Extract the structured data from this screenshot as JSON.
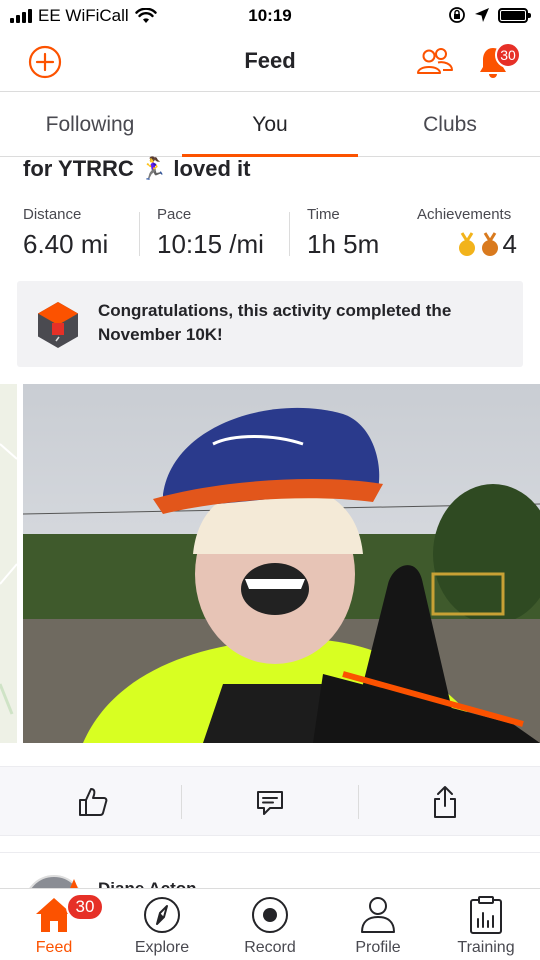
{
  "status_bar": {
    "carrier": "EE WiFiCall",
    "time": "10:19"
  },
  "header": {
    "title": "Feed",
    "notification_count": "30"
  },
  "tabs": [
    {
      "label": "Following",
      "active": false
    },
    {
      "label": "You",
      "active": true
    },
    {
      "label": "Clubs",
      "active": false
    }
  ],
  "activity": {
    "title_text": "for YTRRC 🏃‍♀️ loved it",
    "stats": {
      "distance_label": "Distance",
      "distance_value": "6.40 mi",
      "pace_label": "Pace",
      "pace_value": "10:15 /mi",
      "time_label": "Time",
      "time_value": "1h 5m",
      "achievements_label": "Achievements",
      "achievements_value": "4"
    },
    "congrats_text": "Congratulations, this activity completed the November 10K!"
  },
  "next_card": {
    "athlete_name": "Diane Acton"
  },
  "bottom_nav": {
    "badge": "30",
    "items": [
      {
        "label": "Feed",
        "icon": "home-icon"
      },
      {
        "label": "Explore",
        "icon": "compass-icon"
      },
      {
        "label": "Record",
        "icon": "record-icon"
      },
      {
        "label": "Profile",
        "icon": "profile-icon"
      },
      {
        "label": "Training",
        "icon": "training-icon"
      }
    ]
  },
  "colors": {
    "brand": "#fc5200",
    "badge": "#e63027",
    "text": "#242428"
  }
}
